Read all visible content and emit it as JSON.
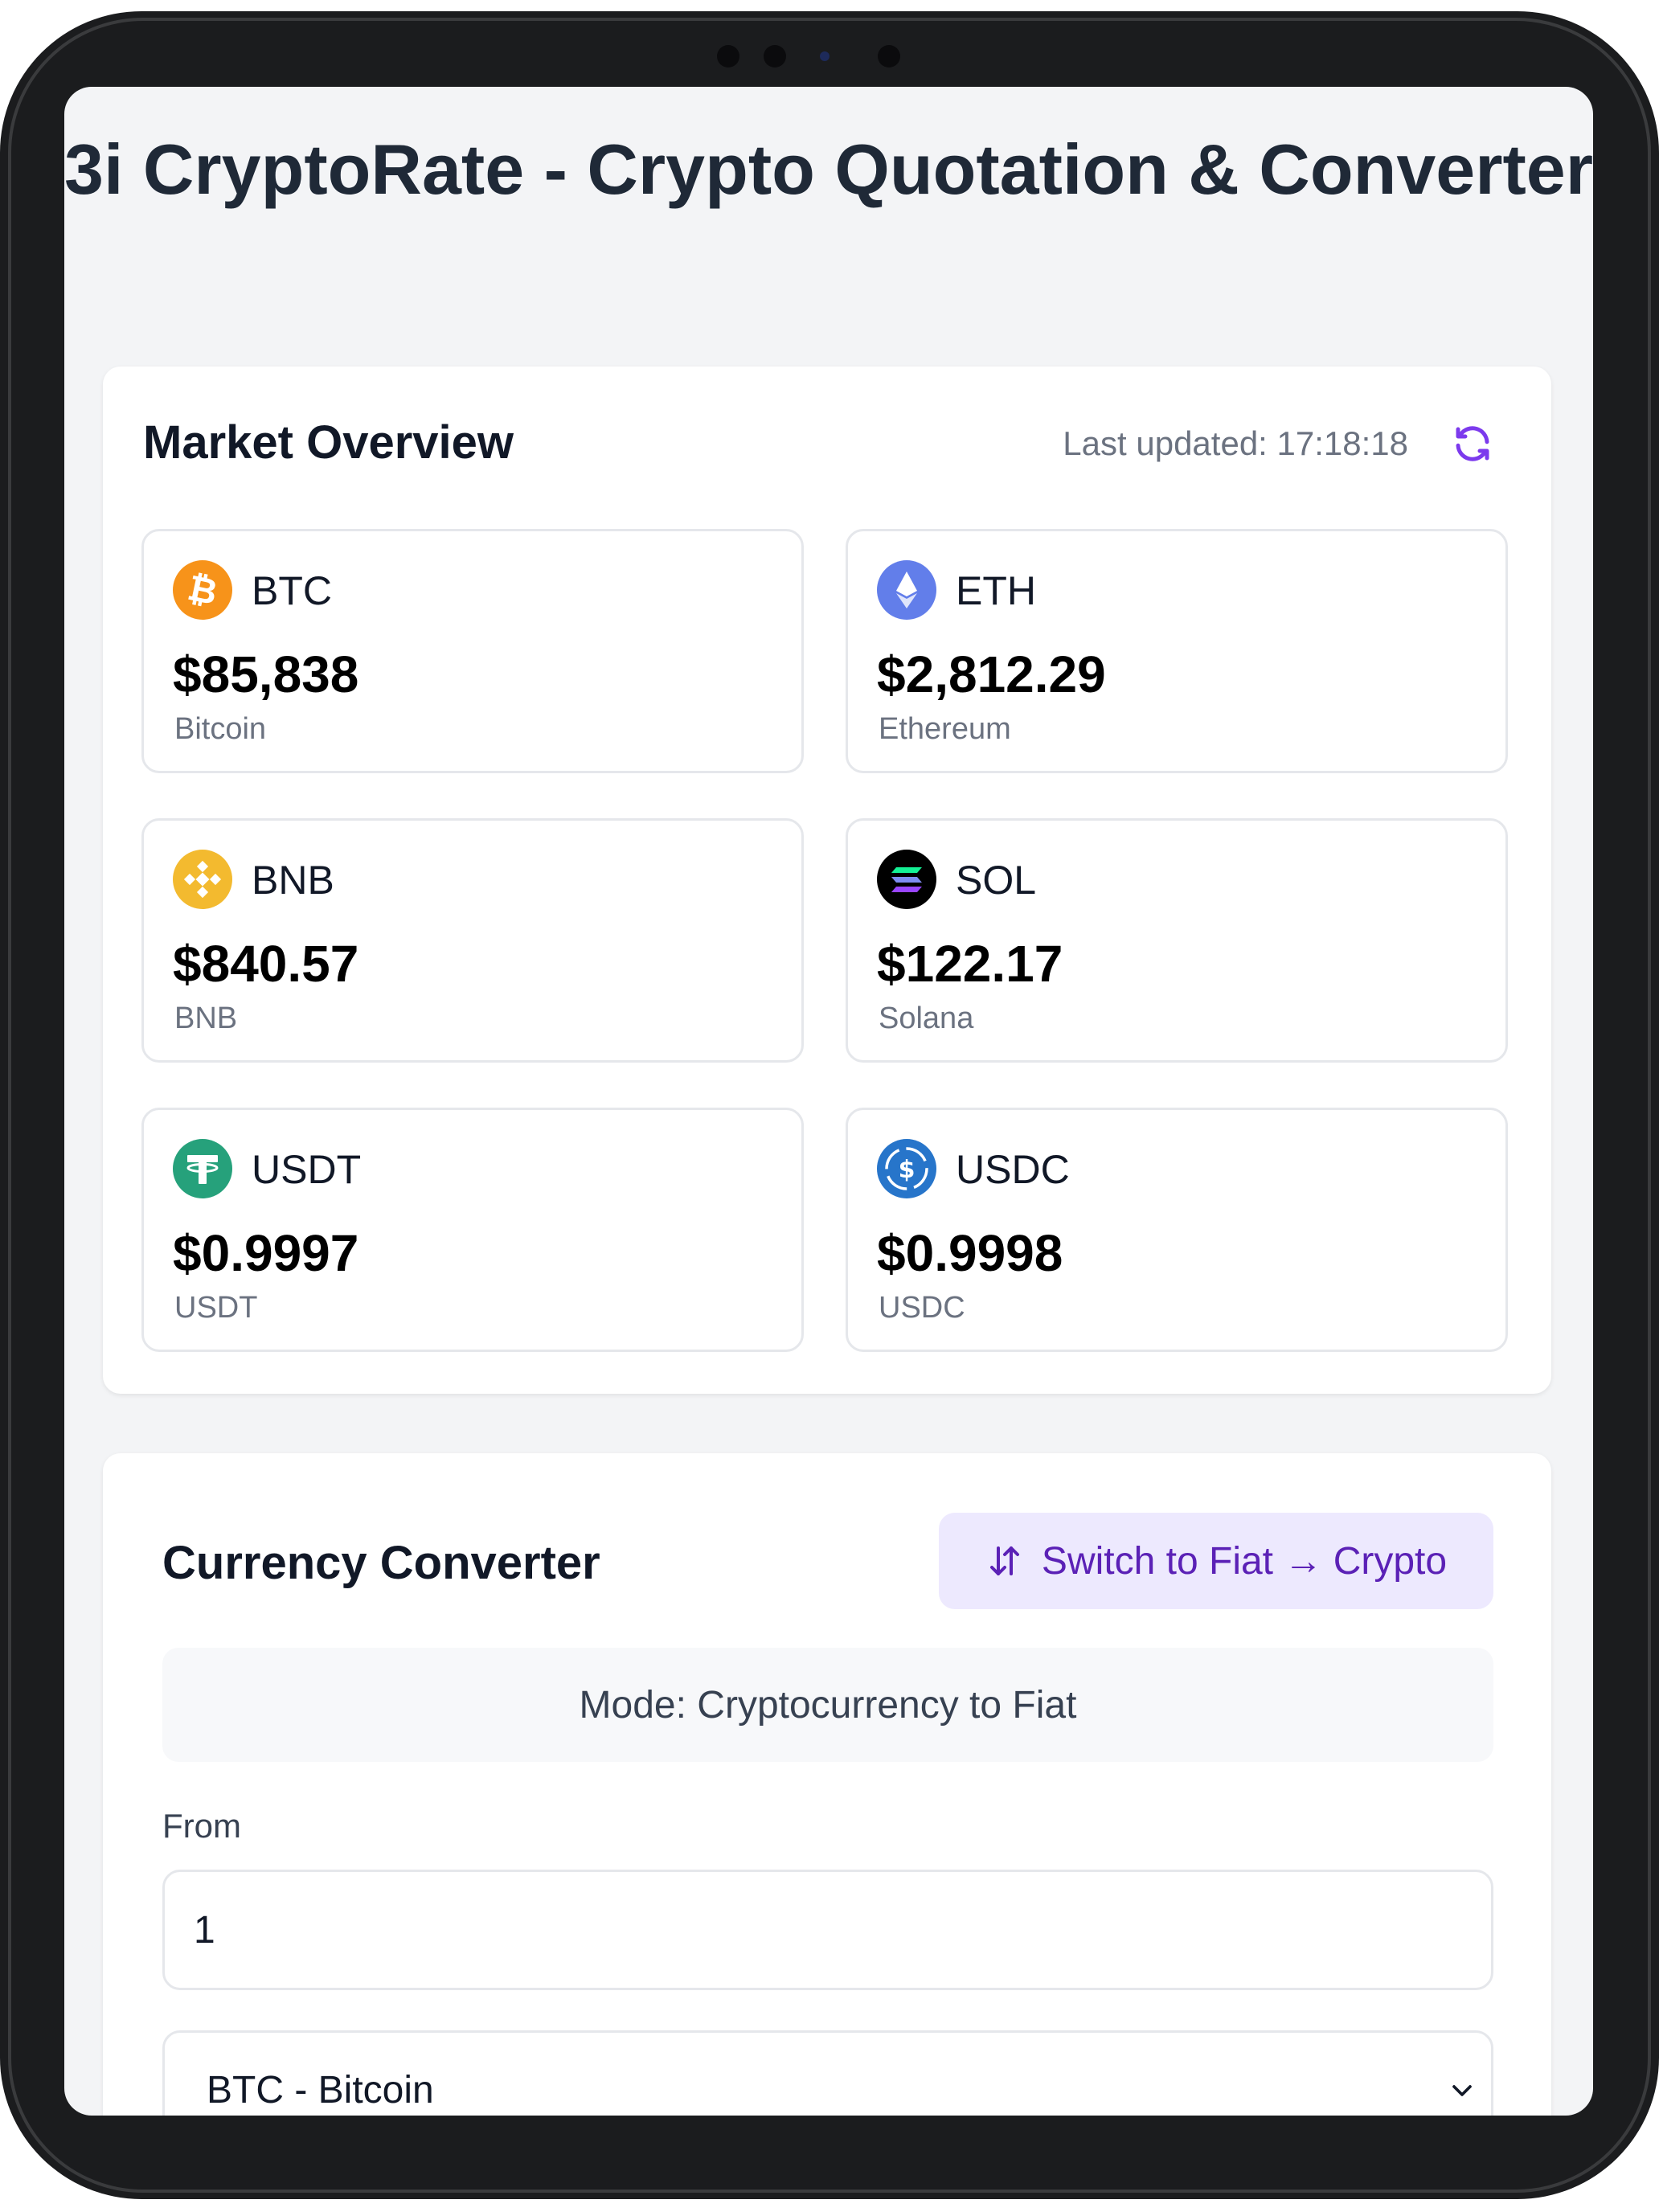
{
  "page": {
    "title": "3i CryptoRate - Crypto Quotation & Converter"
  },
  "market": {
    "title": "Market Overview",
    "last_updated": "Last updated: 17:18:18",
    "coins": [
      {
        "symbol": "BTC",
        "price": "$85,838",
        "name": "Bitcoin",
        "icon": "bitcoin-icon",
        "color": "#f7931a"
      },
      {
        "symbol": "ETH",
        "price": "$2,812.29",
        "name": "Ethereum",
        "icon": "ethereum-icon",
        "color": "#627eea"
      },
      {
        "symbol": "BNB",
        "price": "$840.57",
        "name": "BNB",
        "icon": "bnb-icon",
        "color": "#f3ba2f"
      },
      {
        "symbol": "SOL",
        "price": "$122.17",
        "name": "Solana",
        "icon": "solana-icon",
        "color": "#000000"
      },
      {
        "symbol": "USDT",
        "price": "$0.9997",
        "name": "USDT",
        "icon": "tether-icon",
        "color": "#26a17b"
      },
      {
        "symbol": "USDC",
        "price": "$0.9998",
        "name": "USDC",
        "icon": "usdc-icon",
        "color": "#2775ca"
      }
    ]
  },
  "converter": {
    "title": "Currency Converter",
    "switch_label": "Switch to Fiat → Crypto",
    "mode": "Mode: Cryptocurrency to Fiat",
    "from_label": "From",
    "amount": "1",
    "from_currency": "BTC - Bitcoin"
  },
  "colors": {
    "accent": "#7c3aed",
    "accent_bg": "#ede9fe",
    "background": "#f3f4f6"
  }
}
